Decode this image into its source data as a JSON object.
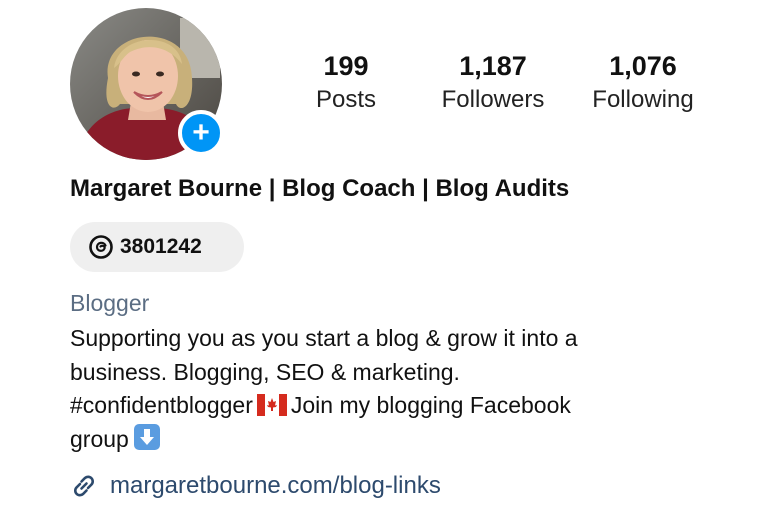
{
  "profile": {
    "name": "Margaret Bourne | Blog Coach | Blog Audits",
    "add_badge_symbol": "+",
    "avatar_icon": "profile-photo"
  },
  "stats": {
    "posts": {
      "value": "199",
      "label": "Posts"
    },
    "followers": {
      "value": "1,187",
      "label": "Followers"
    },
    "following": {
      "value": "1,076",
      "label": "Following"
    }
  },
  "threads": {
    "icon": "threads-icon",
    "count": "3801242"
  },
  "category": "Blogger",
  "bio": {
    "line1": "Supporting you as you start a blog & grow it into a",
    "line2": "business. Blogging, SEO & marketing.",
    "line3_a": "#confidentblogger",
    "line3_b": "Join my blogging Facebook",
    "line4": "group",
    "flag_icon": "canada-flag-icon",
    "arrow_icon": "down-arrow-icon"
  },
  "link": {
    "icon": "link-icon",
    "text": "margaretbourne.com/blog-links"
  },
  "colors": {
    "accent_blue": "#0095f6",
    "pill_bg": "#efefef",
    "category_text": "#5b6d83",
    "link_text": "#2d4a6d"
  }
}
